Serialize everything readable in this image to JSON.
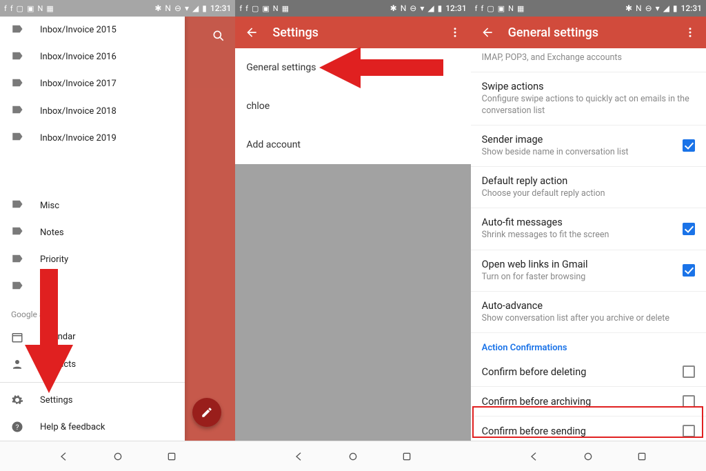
{
  "colors": {
    "primary": "#d14b3c",
    "accent_blue": "#1a73e8",
    "arrow_red": "#e02020"
  },
  "status": {
    "time": "12:31"
  },
  "panel1": {
    "drawer_items_top": [
      "Inbox/Invoice 2015",
      "Inbox/Invoice 2016",
      "Inbox/Invoice 2017",
      "Inbox/Invoice 2018",
      "Inbox/Invoice 2019"
    ],
    "drawer_items_mid": [
      "Misc",
      "Notes",
      "Priority",
      ""
    ],
    "section_title": "Google apps",
    "apps": [
      "Calendar",
      "Contacts"
    ],
    "bottom_items": [
      "Settings",
      "Help & feedback"
    ]
  },
  "panel2": {
    "title": "Settings",
    "items": [
      "General settings",
      "chloe",
      "Add account"
    ]
  },
  "panel3": {
    "title": "General settings",
    "top_sub": "IMAP, POP3, and Exchange accounts",
    "rows": [
      {
        "title": "Swipe actions",
        "sub": "Configure swipe actions to quickly act on emails in the conversation list",
        "check": null
      },
      {
        "title": "Sender image",
        "sub": "Show beside name in conversation list",
        "check": true
      },
      {
        "title": "Default reply action",
        "sub": "Choose your default reply action",
        "check": null
      },
      {
        "title": "Auto-fit messages",
        "sub": "Shrink messages to fit the screen",
        "check": true
      },
      {
        "title": "Open web links in Gmail",
        "sub": "Turn on for faster browsing",
        "check": true
      },
      {
        "title": "Auto-advance",
        "sub": "Show conversation list after you archive or delete",
        "check": null
      }
    ],
    "section": "Action Confirmations",
    "confirm_rows": [
      {
        "title": "Confirm before deleting",
        "check": false
      },
      {
        "title": "Confirm before archiving",
        "check": false
      },
      {
        "title": "Confirm before sending",
        "check": false
      }
    ]
  }
}
